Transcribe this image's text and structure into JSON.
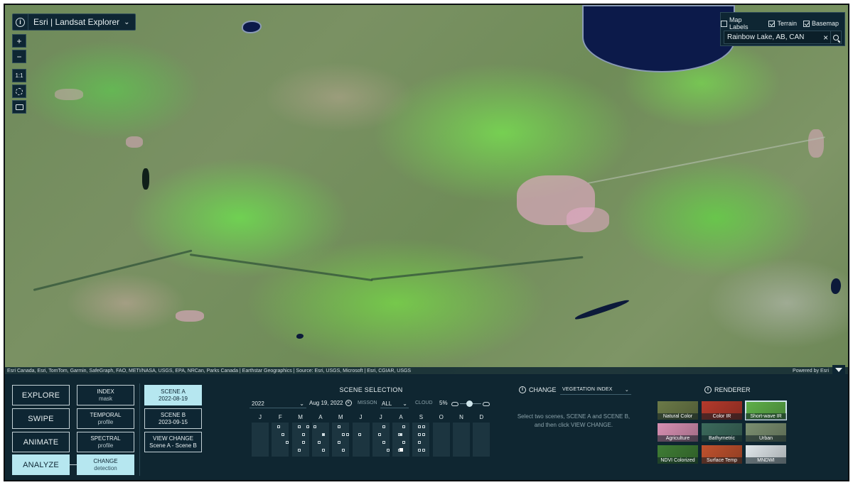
{
  "app": {
    "title": "Esri | Landsat Explorer"
  },
  "map_tools": {
    "zoom_in": "+",
    "zoom_out": "−",
    "one_to_one": "1:1"
  },
  "map_options": {
    "toggles": [
      {
        "label": "Map Labels",
        "checked": false
      },
      {
        "label": "Terrain",
        "checked": true
      },
      {
        "label": "Basemap",
        "checked": true
      }
    ],
    "search_value": "Rainbow Lake, AB, CAN"
  },
  "attribution": {
    "left": "Esri Canada, Esri, TomTom, Garmin, SafeGraph, FAO, METI/NASA, USGS, EPA, NRCan, Parks Canada | Earthstar Geographics | Source: Esri, USGS, Microsoft | Esri, CGIAR, USGS",
    "right": "Powered by Esri"
  },
  "modes": [
    {
      "label": "EXPLORE",
      "active": false
    },
    {
      "label": "SWIPE",
      "active": false
    },
    {
      "label": "ANIMATE",
      "active": false
    },
    {
      "label": "ANALYZE",
      "active": true
    }
  ],
  "analyze_tools": [
    {
      "label": "INDEX",
      "sub": "mask",
      "active": false
    },
    {
      "label": "TEMPORAL",
      "sub": "profile",
      "active": false
    },
    {
      "label": "SPECTRAL",
      "sub": "profile",
      "active": false
    },
    {
      "label": "CHANGE",
      "sub": "detection",
      "active": true
    }
  ],
  "scenes": [
    {
      "label": "SCENE A",
      "sub": "2022-08-19",
      "active": true
    },
    {
      "label": "SCENE B",
      "sub": "2023-09-15",
      "active": false
    },
    {
      "label": "VIEW CHANGE",
      "sub": "Scene A - Scene B",
      "active": false
    }
  ],
  "scene_selection": {
    "title": "SCENE SELECTION",
    "year": "2022",
    "date": "Aug 19, 2022",
    "mission_label": "MISSON",
    "mission_value": "ALL",
    "cloud_label": "CLOUD",
    "cloud_pct": "5%",
    "cloud_fraction": 0.05,
    "months": [
      "J",
      "F",
      "M",
      "A",
      "M",
      "J",
      "J",
      "A",
      "S",
      "O",
      "N",
      "D"
    ]
  },
  "change": {
    "title": "CHANGE",
    "index_value": "VEGETATION INDEX",
    "instructions": "Select two scenes, SCENE A and SCENE B, and then click VIEW CHANGE."
  },
  "renderer": {
    "title": "RENDERER",
    "tiles": [
      {
        "label": "Natural Color",
        "color": "#6b7a48",
        "selected": false
      },
      {
        "label": "Color IR",
        "color": "#b43a2c",
        "selected": false
      },
      {
        "label": "Short-wave IR",
        "color": "#5fb04a",
        "selected": true
      },
      {
        "label": "Agriculture",
        "color": "#d78fb2",
        "selected": false
      },
      {
        "label": "Bathymetric",
        "color": "#3c6a5c",
        "selected": false
      },
      {
        "label": "Urban",
        "color": "#7b8f70",
        "selected": false
      },
      {
        "label": "NDVI Colorized",
        "color": "#3f7d35",
        "selected": false
      },
      {
        "label": "Surface Temp",
        "color": "#c0522e",
        "selected": false
      },
      {
        "label": "MNDWI",
        "color": "#dfe6ea",
        "selected": false
      }
    ]
  }
}
